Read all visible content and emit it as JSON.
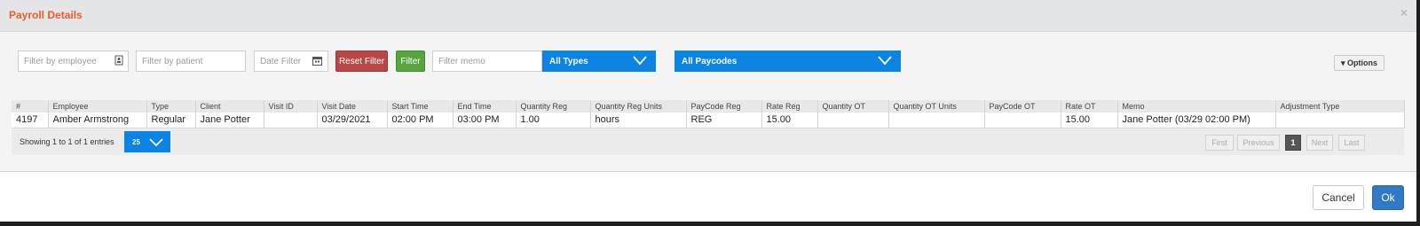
{
  "dialog": {
    "title": "Payroll Details",
    "close_glyph": "×"
  },
  "filters": {
    "employee_placeholder": "Filter by employee",
    "patient_placeholder": "Filter by patient",
    "date_placeholder": "Date Filter",
    "reset_label": "Reset Filter",
    "filter_label": "Filter",
    "memo_placeholder": "Filter memo",
    "types_selected": "All Types",
    "paycodes_selected": "All Paycodes",
    "options_label": "▾ Options"
  },
  "icons": {
    "employee": "contact-card-icon",
    "date": "calendar-icon",
    "dropdown": "chevron-down-icon"
  },
  "table": {
    "columns": [
      "#",
      "Employee",
      "Type",
      "Client",
      "Visit ID",
      "Visit Date",
      "Start Time",
      "End Time",
      "Quantity Reg",
      "Quantity Reg Units",
      "PayCode Reg",
      "Rate Reg",
      "Quantity OT",
      "Quantity OT Units",
      "PayCode OT",
      "Rate OT",
      "Memo",
      "Adjustment Type"
    ],
    "rows": [
      [
        "4197",
        "Amber Armstrong",
        "Regular",
        "Jane Potter",
        "",
        "03/29/2021",
        "02:00 PM",
        "03:00 PM",
        "1.00",
        "hours",
        "REG",
        "15.00",
        "",
        "",
        "",
        "15.00",
        "Jane Potter (03/29 02:00 PM)",
        ""
      ]
    ]
  },
  "pagination": {
    "showing_text": "Showing 1 to 1 of 1 entries",
    "page_size": "25",
    "first": "First",
    "previous": "Previous",
    "current": "1",
    "next": "Next",
    "last": "Last"
  },
  "footer": {
    "cancel_label": "Cancel",
    "ok_label": "Ok"
  },
  "colors": {
    "title": "#f15a24",
    "select_blue": "#0b84e3",
    "reset_red": "#b94745",
    "filter_green": "#58a540",
    "ok_blue": "#2f7ac2"
  }
}
